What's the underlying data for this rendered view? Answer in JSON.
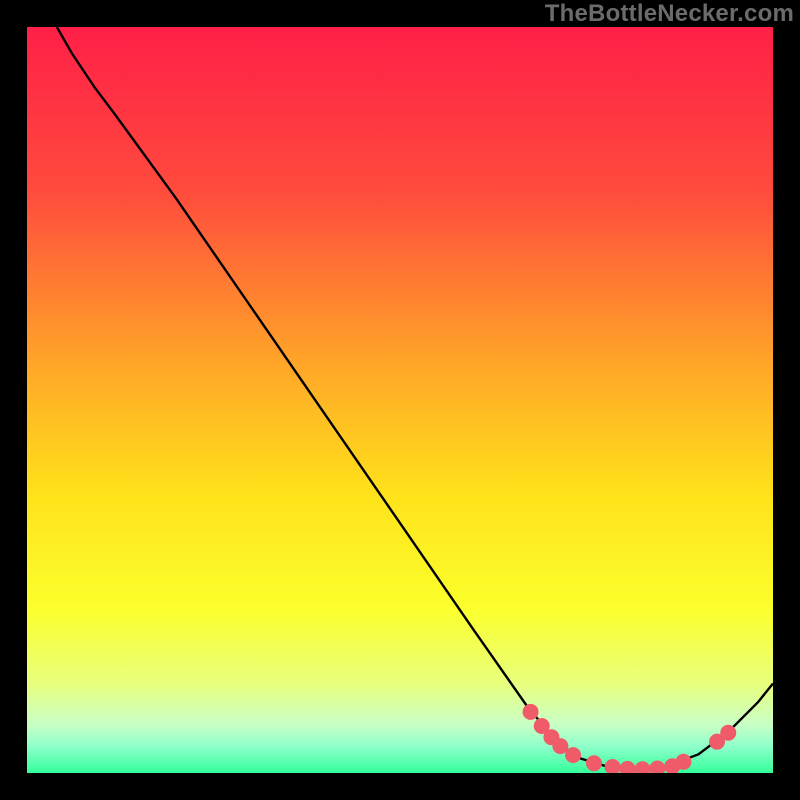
{
  "attribution": "TheBottleNecker.com",
  "chart_data": {
    "type": "line",
    "title": "",
    "xlabel": "",
    "ylabel": "",
    "xlim": [
      0,
      100
    ],
    "ylim": [
      0,
      100
    ],
    "grid": false,
    "background_gradient": {
      "stops": [
        {
          "offset": 0.0,
          "color": "#ff1f47"
        },
        {
          "offset": 0.22,
          "color": "#ff4b3d"
        },
        {
          "offset": 0.45,
          "color": "#ffa528"
        },
        {
          "offset": 0.63,
          "color": "#ffe31a"
        },
        {
          "offset": 0.78,
          "color": "#fbff2b"
        },
        {
          "offset": 0.88,
          "color": "#e8ff7d"
        },
        {
          "offset": 0.935,
          "color": "#c9ffc6"
        },
        {
          "offset": 0.965,
          "color": "#8dffc9"
        },
        {
          "offset": 1.0,
          "color": "#33ff9b"
        }
      ]
    },
    "series": [
      {
        "name": "curve",
        "stroke": "#000000",
        "points": [
          {
            "x": 4.0,
            "y": 100.0
          },
          {
            "x": 6.0,
            "y": 96.5
          },
          {
            "x": 9.0,
            "y": 92.0
          },
          {
            "x": 12.0,
            "y": 88.0
          },
          {
            "x": 20.0,
            "y": 77.0
          },
          {
            "x": 30.0,
            "y": 62.5
          },
          {
            "x": 40.0,
            "y": 48.0
          },
          {
            "x": 50.0,
            "y": 33.5
          },
          {
            "x": 60.0,
            "y": 19.0
          },
          {
            "x": 67.0,
            "y": 9.0
          },
          {
            "x": 71.0,
            "y": 4.2
          },
          {
            "x": 74.0,
            "y": 2.0
          },
          {
            "x": 78.0,
            "y": 0.8
          },
          {
            "x": 82.0,
            "y": 0.5
          },
          {
            "x": 86.0,
            "y": 1.0
          },
          {
            "x": 90.0,
            "y": 2.5
          },
          {
            "x": 94.0,
            "y": 5.5
          },
          {
            "x": 98.0,
            "y": 9.5
          },
          {
            "x": 100.0,
            "y": 12.0
          }
        ]
      }
    ],
    "markers": {
      "color": "#ef5b68",
      "points": [
        {
          "x": 67.5,
          "y": 8.2
        },
        {
          "x": 69.0,
          "y": 6.3
        },
        {
          "x": 70.3,
          "y": 4.8
        },
        {
          "x": 71.5,
          "y": 3.6
        },
        {
          "x": 73.2,
          "y": 2.4
        },
        {
          "x": 76.0,
          "y": 1.3
        },
        {
          "x": 78.5,
          "y": 0.8
        },
        {
          "x": 80.5,
          "y": 0.55
        },
        {
          "x": 82.5,
          "y": 0.5
        },
        {
          "x": 84.5,
          "y": 0.6
        },
        {
          "x": 86.5,
          "y": 0.9
        },
        {
          "x": 88.0,
          "y": 1.5
        },
        {
          "x": 92.5,
          "y": 4.2
        },
        {
          "x": 94.0,
          "y": 5.4
        }
      ]
    }
  }
}
